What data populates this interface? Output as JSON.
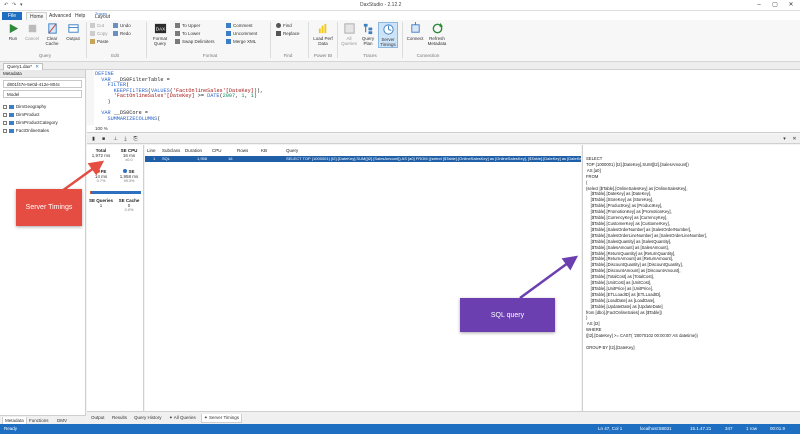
{
  "window": {
    "title": "DaxStudio - 2.12.2",
    "quick_access": [
      "↶",
      "↷",
      "▾"
    ],
    "controls": {
      "minimize": "–",
      "maximize": "▢",
      "close": "✕"
    }
  },
  "ribbon_tabs": {
    "file": "File",
    "home": "Home",
    "advanced": "Advanced",
    "help": "Help",
    "context_group": "Traces",
    "layout": "Layout"
  },
  "ribbon": {
    "run": "Run",
    "cancel": "Cancel",
    "clear_cache": "Clear Cache",
    "output": "Output",
    "query_group": "Query",
    "cut": "Cut",
    "copy": "Copy",
    "paste": "Paste",
    "undo": "Undo",
    "redo": "Redo",
    "edit_group": "Edit",
    "format_query": "Format Query",
    "to_upper": "To Upper",
    "to_lower": "To Lower",
    "swap_delimiters": "Swap Delimiters",
    "comment": "Comment",
    "uncomment": "Uncomment",
    "merge_xml": "Merge XML",
    "format_group": "Format",
    "find": "Find",
    "replace": "Replace",
    "find_group": "Find",
    "load_perf_data": "Load Perf Data",
    "powerbi_group": "Power BI",
    "all_queries": "All Queries",
    "query_plan": "Query Plan",
    "server_timings": "Server Timings",
    "traces_group": "Traces",
    "connect": "Connect",
    "refresh_metadata": "Refresh Metadata",
    "connection_group": "Connection"
  },
  "doc_tab": {
    "label": "Query1.dax*",
    "close": "✕"
  },
  "metadata": {
    "header": "Metadata",
    "model_selector": "d801f47e-5e0d-412e-804c",
    "model": "Model",
    "tables": [
      "DimGeography",
      "DimProduct",
      "DimProductCategory",
      "FactOnlineSales"
    ],
    "bottom_tabs": [
      "Metadata",
      "Functions",
      "DMV"
    ]
  },
  "editor": {
    "lines": [
      [
        {
          "t": "DEFINE",
          "c": "kw"
        }
      ],
      [
        {
          "t": "  VAR ",
          "c": "kw"
        },
        {
          "t": "__DS0FilterTable = "
        }
      ],
      [
        {
          "t": "    FILTER",
          "c": "fn"
        },
        {
          "t": "("
        }
      ],
      [
        {
          "t": "      KEEPFILTERS",
          "c": "fn"
        },
        {
          "t": "("
        },
        {
          "t": "VALUES",
          "c": "fn"
        },
        {
          "t": "("
        },
        {
          "t": "'FactOnlineSales'[DateKey]",
          "c": "st"
        },
        {
          "t": ")),"
        }
      ],
      [
        {
          "t": "      'FactOnlineSales'[DateKey]",
          "c": "st"
        },
        {
          "t": " >= "
        },
        {
          "t": "DATE",
          "c": "fn"
        },
        {
          "t": "("
        },
        {
          "t": "2007",
          "c": "nm"
        },
        {
          "t": ", "
        },
        {
          "t": "1",
          "c": "nm"
        },
        {
          "t": ", "
        },
        {
          "t": "1",
          "c": "nm"
        },
        {
          "t": ")"
        }
      ],
      [
        {
          "t": "    )"
        }
      ],
      [
        {
          "t": ""
        }
      ],
      [
        {
          "t": "  VAR ",
          "c": "kw"
        },
        {
          "t": "__DS0Core = "
        }
      ],
      [
        {
          "t": "    SUMMARIZECOLUMNS",
          "c": "fn"
        },
        {
          "t": "("
        }
      ]
    ],
    "zoom": "100 %"
  },
  "timings": {
    "total_label": "Total",
    "total_value": "1,972 ms",
    "se_cpu_label": "SE CPU",
    "se_cpu_value": "16 ms",
    "se_cpu_sub": "x0.0",
    "fe_label": "FE",
    "fe_value": "14 ms",
    "fe_pct": "0.7%",
    "fe_fraction": 0.007,
    "se_label": "SE",
    "se_value": "1,958 ms",
    "se_pct": "99.3%",
    "se_queries_label": "SE Queries",
    "se_queries_value": "1",
    "se_cache_label": "SE Cache",
    "se_cache_value": "0",
    "se_cache_pct": "0.0%"
  },
  "query_table": {
    "headers": [
      "Line",
      "Subclass",
      "Duration",
      "CPU",
      "Rows",
      "KB",
      "Query"
    ],
    "rows": [
      [
        "1",
        "SQL",
        "1,958",
        "16",
        "",
        "",
        "SELECT TOP (1000001) [t2].[DateKey],SUM([t2].[SalesAmount]) AS [a0] FROM ((select [$Table].[OnlineSalesKey] as [OnlineSalesKey], [$Table].[DateKey] as [DateKey]"
      ]
    ]
  },
  "sql_text": [
    "SELECT",
    "TOP (1000001) [t2].[DateKey],SUM([t2].[SalesAmount])",
    " AS [a0]",
    "FROM",
    "(",
    "(select [$Table].[OnlineSalesKey] as [OnlineSalesKey],",
    "    [$Table].[DateKey] as [DateKey],",
    "    [$Table].[StoreKey] as [StoreKey],",
    "    [$Table].[ProductKey] as [ProductKey],",
    "    [$Table].[PromotionKey] as [PromotionKey],",
    "    [$Table].[CurrencyKey] as [CurrencyKey],",
    "    [$Table].[CustomerKey] as [CustomerKey],",
    "    [$Table].[SalesOrderNumber] as [SalesOrderNumber],",
    "    [$Table].[SalesOrderLineNumber] as [SalesOrderLineNumber],",
    "    [$Table].[SalesQuantity] as [SalesQuantity],",
    "    [$Table].[SalesAmount] as [SalesAmount],",
    "    [$Table].[ReturnQuantity] as [ReturnQuantity],",
    "    [$Table].[ReturnAmount] as [ReturnAmount],",
    "    [$Table].[DiscountQuantity] as [DiscountQuantity],",
    "    [$Table].[DiscountAmount] as [DiscountAmount],",
    "    [$Table].[TotalCost] as [TotalCost],",
    "    [$Table].[UnitCost] as [UnitCost],",
    "    [$Table].[UnitPrice] as [UnitPrice],",
    "    [$Table].[ETLLoadID] as [ETLLoadID],",
    "    [$Table].[LoadDate] as [LoadDate],",
    "    [$Table].[UpdateDate] as [UpdateDate]",
    "from [dbo].[FactOnlineSales] as [$Table])",
    ")",
    " AS [t2]",
    "WHERE",
    "([t2].[DateKey] >= CAST( '20070102 00:00:00' AS datetime))",
    "",
    "GROUP BY [t2].[DateKey]"
  ],
  "bottom_tabs": [
    "Output",
    "Results",
    "Query History",
    "All Queries",
    "Server Timings"
  ],
  "status": {
    "ready": "Ready",
    "position": "Ln 47, Col 1",
    "server": "localhost:58031",
    "version": "15.1.47.21",
    "spid": "347",
    "rows": "1 row",
    "time": "00:01.9"
  },
  "callouts": {
    "server_timings": "Server Timings",
    "sql_query": "SQL query"
  },
  "colors": {
    "accent": "#1e6fc2",
    "fe": "#e05a2b",
    "se": "#2f6fc0",
    "callout_red": "#e54d43",
    "callout_purple": "#6b3fb0",
    "selected_row": "#1f5fa8"
  }
}
